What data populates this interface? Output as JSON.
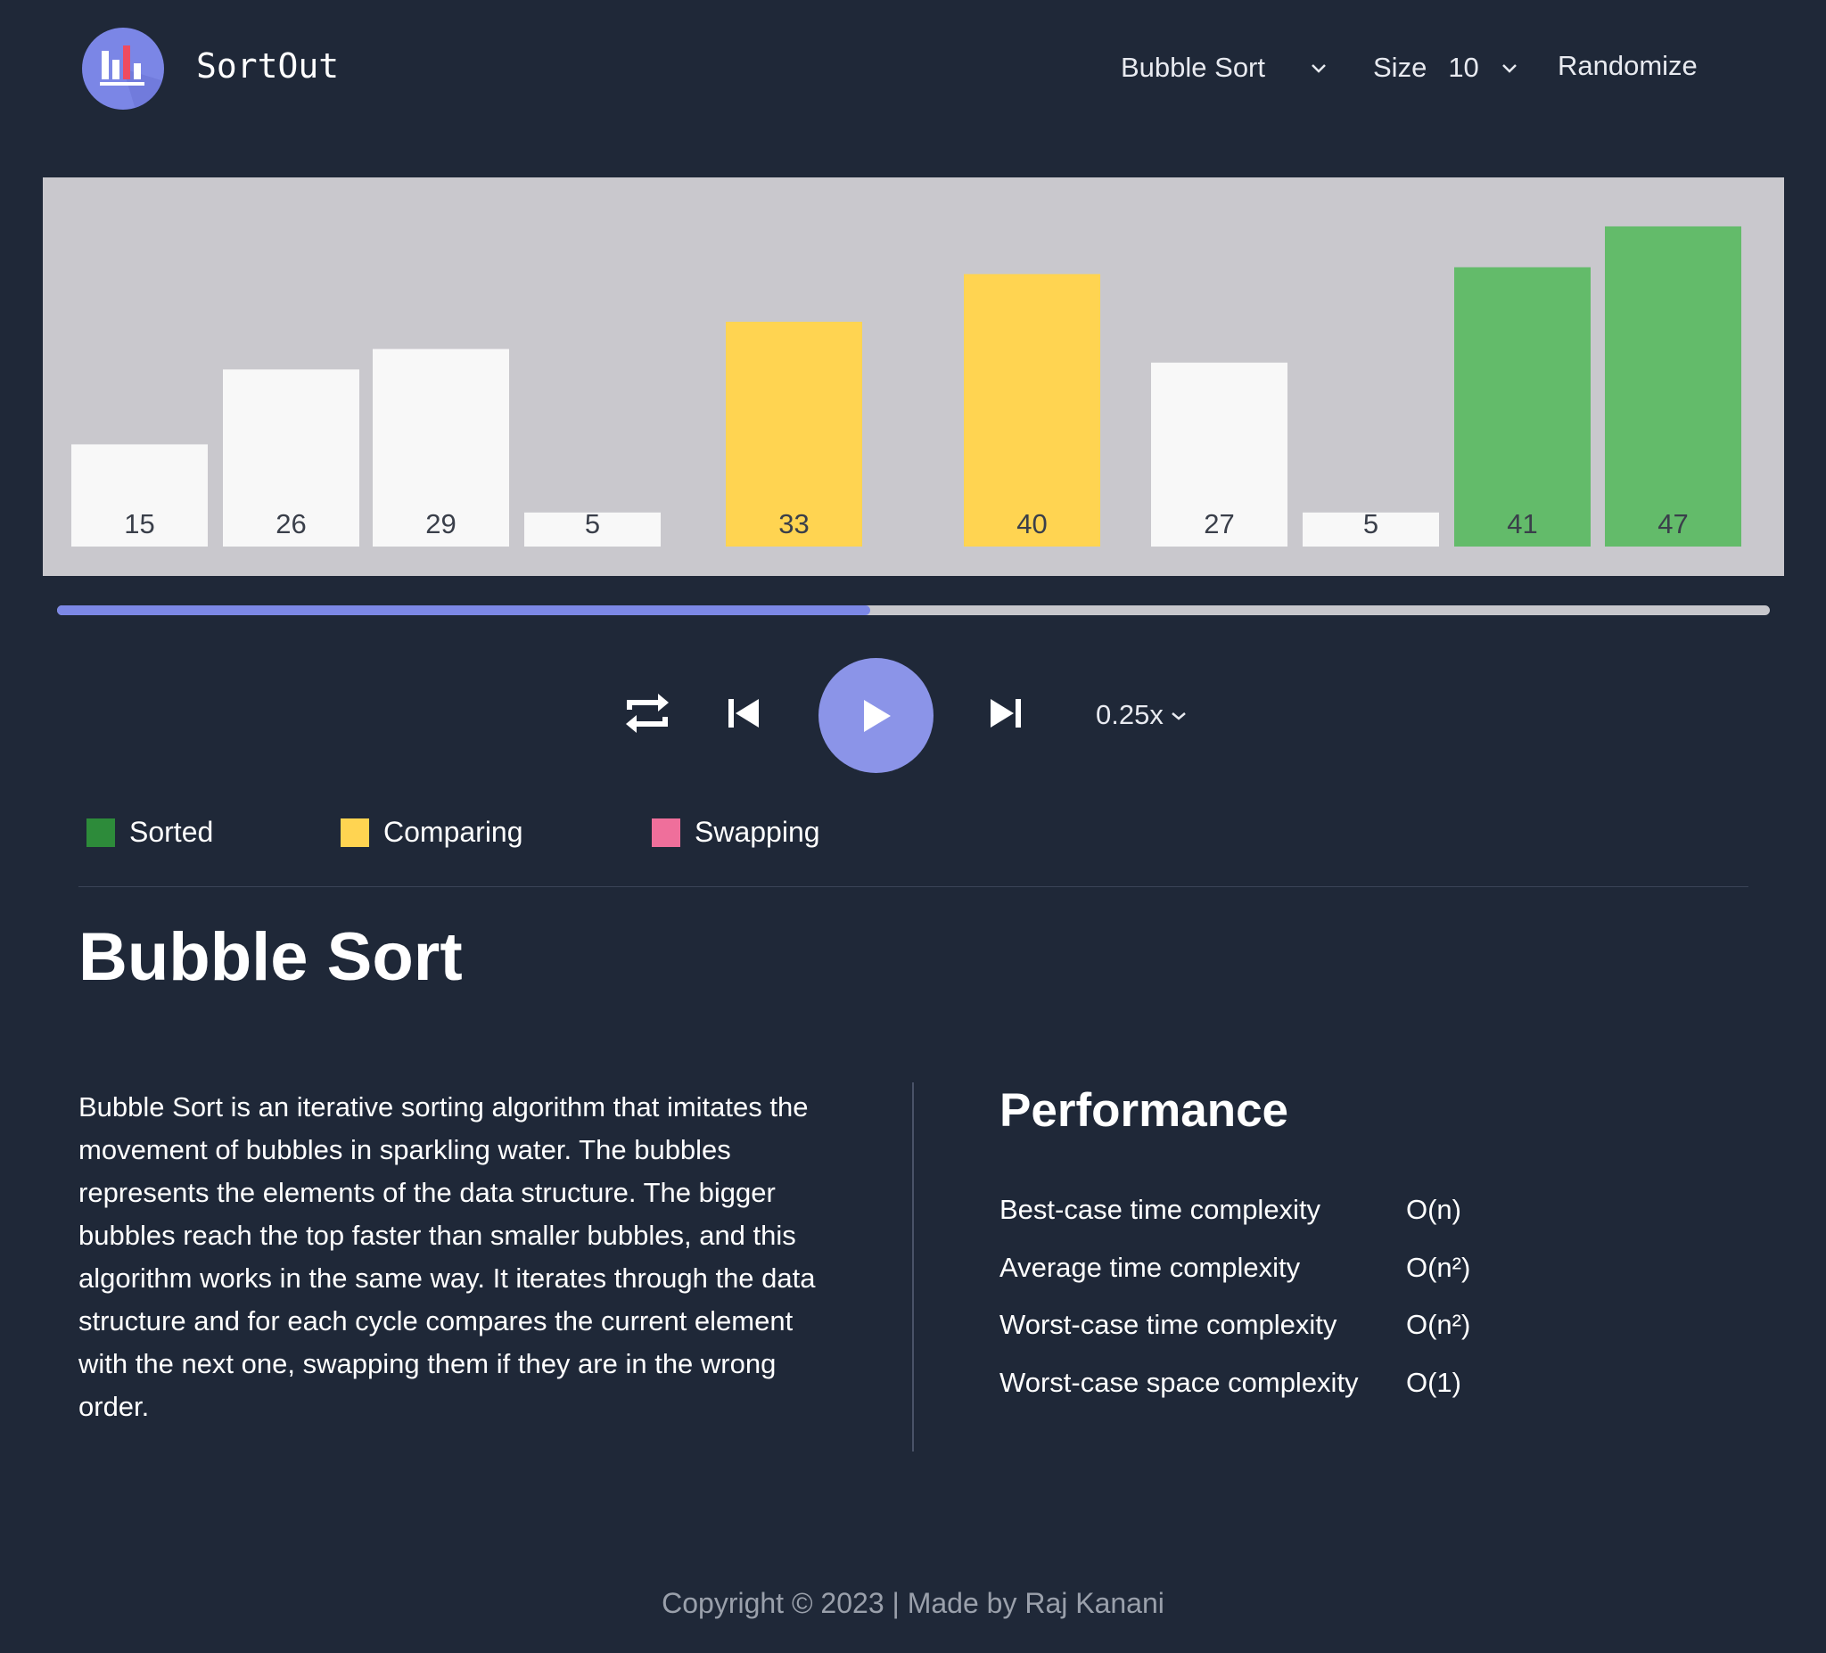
{
  "header": {
    "brand": "SortOut",
    "algorithm_select": {
      "value": "Bubble Sort",
      "icon": "chevron-down-icon"
    },
    "size_select": {
      "label": "Size",
      "value": "10",
      "icon": "chevron-down-icon"
    },
    "randomize_label": "Randomize"
  },
  "chart_data": {
    "type": "bar",
    "categories": [
      "15",
      "26",
      "29",
      "5",
      "33",
      "40",
      "27",
      "5",
      "41",
      "47"
    ],
    "values": [
      15,
      26,
      29,
      5,
      33,
      40,
      27,
      5,
      41,
      47
    ],
    "states": [
      "default",
      "default",
      "default",
      "default",
      "comparing",
      "comparing",
      "default",
      "default",
      "sorted",
      "sorted"
    ],
    "ylim": [
      0,
      50
    ],
    "colors": {
      "default": "#f8f8f8",
      "comparing": "#ffd451",
      "sorted": "#63bb6a",
      "swapping": "#ef6f9b"
    }
  },
  "progress": {
    "value": 0.475
  },
  "controls": {
    "repeat": "repeat-icon",
    "previous": "skip-previous-icon",
    "play": "play-icon",
    "next": "skip-next-icon",
    "speed": "0.25x"
  },
  "legend": [
    {
      "label": "Sorted",
      "color": "#2d8b3a"
    },
    {
      "label": "Comparing",
      "color": "#ffd451"
    },
    {
      "label": "Swapping",
      "color": "#ef6f9b"
    }
  ],
  "main": {
    "title": "Bubble Sort",
    "description": "Bubble Sort is an iterative sorting algorithm that imitates the movement of bubbles in sparkling water. The bubbles represents the elements of the data structure. The bigger bubbles reach the top faster than smaller bubbles, and this algorithm works in the same way. It iterates through the data structure and for each cycle compares the current element with the next one, swapping them if they are in the wrong order.",
    "performance": {
      "title": "Performance",
      "rows": [
        {
          "label": "Best-case time complexity",
          "value": "O(n)"
        },
        {
          "label": "Average time complexity",
          "value": "O(n²)"
        },
        {
          "label": "Worst-case time complexity",
          "value": "O(n²)"
        },
        {
          "label": "Worst-case space complexity",
          "value": "O(1)"
        }
      ]
    }
  },
  "footer": {
    "text": "Copyright © 2023 | Made by Raj Kanani"
  }
}
